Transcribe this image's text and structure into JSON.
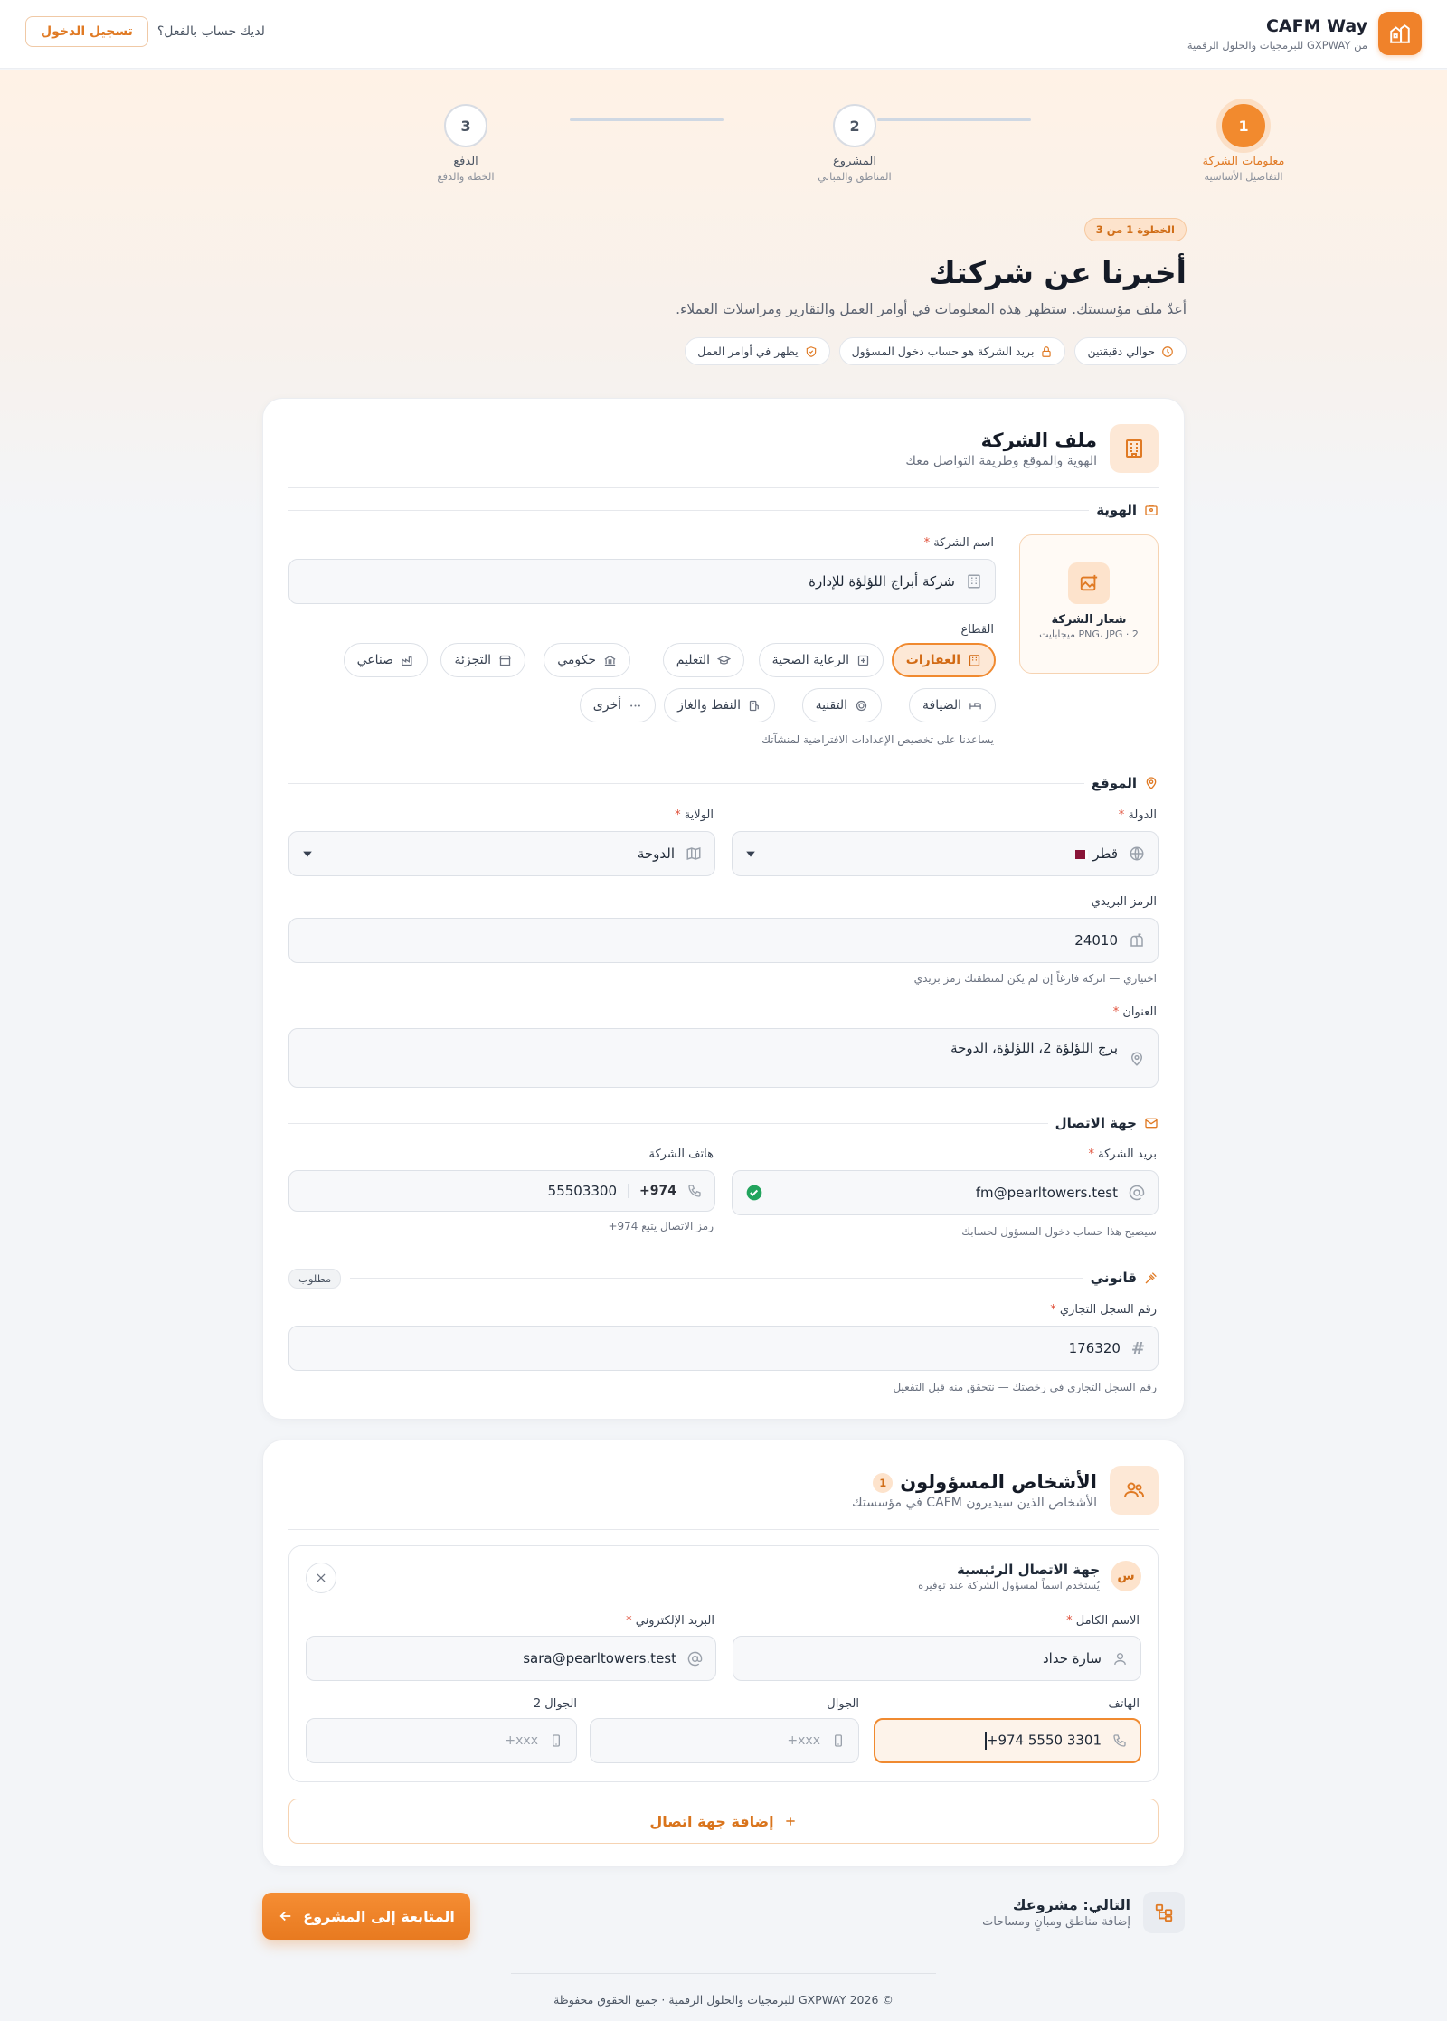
{
  "header": {
    "app_name": "CAFM Way",
    "app_sub": "من GXPWAY للبرمجيات والحلول الرقمية",
    "login_question": "لديك حساب بالفعل؟",
    "login_button": "تسجيل الدخول"
  },
  "stepper": {
    "steps": [
      {
        "number": "1",
        "title": "معلومات الشركة",
        "sub": "التفاصيل الأساسية"
      },
      {
        "number": "2",
        "title": "المشروع",
        "sub": "المناطق والمباني"
      },
      {
        "number": "3",
        "title": "الدفع",
        "sub": "الخطة والدفع"
      }
    ]
  },
  "intro": {
    "step_badge": "الخطوة 1 من 3",
    "title": "أخبرنا عن شركتك",
    "subtitle": "أعدّ ملف مؤسستك. ستظهر هذه المعلومات في أوامر العمل والتقارير ومراسلات العملاء.",
    "chips": [
      "حوالي دقيقتين",
      "بريد الشركة هو حساب دخول المسؤول",
      "يظهر في أوامر العمل"
    ]
  },
  "company_card": {
    "title": "ملف الشركة",
    "subtitle": "الهوية والموقع وطريقة التواصل معك",
    "identity": {
      "section_label": "الهوية",
      "logo_title": "شعار الشركة",
      "logo_sub": "PNG، JPG · 2 ميجابايت",
      "name_label": "اسم الشركة",
      "name_value": "شركة أبراج اللؤلؤة للإدارة",
      "sector_label": "القطاع",
      "sectors_row1": [
        "العقارات",
        "الرعاية الصحية",
        "التعليم",
        "حكومي",
        "التجزئة",
        "صناعي"
      ],
      "sectors_row2": [
        "الضيافة",
        "التقنية",
        "النفط والغاز",
        "أخرى"
      ],
      "sector_hint": "يساعدنا على تخصيص الإعدادات الافتراضية لمنشآتك"
    },
    "location": {
      "section_label": "الموقع",
      "country_label": "الدولة",
      "country_value": "قطر",
      "state_label": "الولاية",
      "state_value": "الدوحة",
      "postal_label": "الرمز البريدي",
      "postal_value": "24010",
      "postal_hint": "اختياري — اتركه فارغاً إن لم يكن لمنطقتك رمز بريدي",
      "address_label": "العنوان",
      "address_value": "برج اللؤلؤة 2، اللؤلؤة، الدوحة"
    },
    "contact": {
      "section_label": "جهة الاتصال",
      "email_label": "بريد الشركة",
      "email_value": "fm@pearltowers.test",
      "email_hint": "سيصبح هذا حساب دخول المسؤول لحسابك",
      "phone_label": "هاتف الشركة",
      "phone_code": "+974",
      "phone_value": "55503300",
      "phone_hint": "رمز الاتصال يتبع 974+"
    },
    "legal": {
      "section_label": "قانوني",
      "required_pill": "مطلوب",
      "cr_label": "رقم السجل التجاري",
      "cr_value": "176320",
      "cr_hint": "رقم السجل التجاري في رخصتك — نتحقق منه قبل التفعيل"
    }
  },
  "people_card": {
    "title": "الأشخاص المسؤولون",
    "count": "1",
    "subtitle": "الأشخاص الذين سيديرون CAFM في مؤسستك",
    "contact": {
      "avatar": "س",
      "title": "جهة الاتصال الرئيسية",
      "sub": "يُستخدم اسماً لمسؤول الشركة عند توفيره",
      "fullname_label": "الاسم الكامل",
      "fullname_value": "سارة حداد",
      "email_label": "البريد الإلكتروني",
      "email_value": "sara@pearltowers.test",
      "phone_label": "الهاتف",
      "phone_value": "+974 5550 3301",
      "mobile_label": "الجوال",
      "mobile_placeholder": "+xxx",
      "mobile2_label": "الجوال 2",
      "mobile2_placeholder": "+xxx"
    },
    "add_button": "إضافة جهة اتصال"
  },
  "footer": {
    "next_title": "التالي: مشروعك",
    "next_sub": "إضافة مناطق ومبانٍ ومساحات",
    "continue_button": "المتابعة إلى المشروع",
    "copyright": "© 2026 GXPWAY للبرمجيات والحلول الرقمية · جميع الحقوق محفوظة"
  },
  "colors": {
    "accent": "#f0822a",
    "accent_light": "#fde8d6",
    "success": "#22a45d"
  }
}
